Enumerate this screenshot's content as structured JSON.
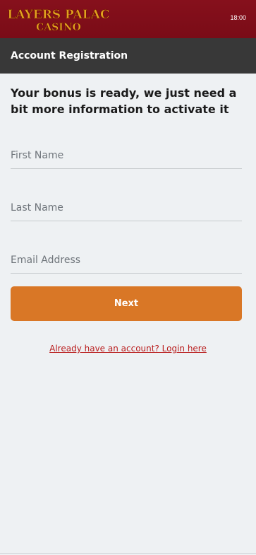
{
  "status_bar": {
    "time": "18:00"
  },
  "brand": {
    "line1": "PLAYERS PALACE",
    "line2": "CASINO",
    "logo_color": "#e0a21f",
    "topbar_color": "#7f0e19"
  },
  "header": {
    "title": "Account Registration"
  },
  "intro": {
    "text": "Your bonus is ready, we just need a bit more information to activate it"
  },
  "form": {
    "first_name": {
      "placeholder": "First Name",
      "value": ""
    },
    "last_name": {
      "placeholder": "Last Name",
      "value": ""
    },
    "email": {
      "placeholder": "Email Address",
      "value": ""
    },
    "next_label": "Next",
    "next_color": "#d97726"
  },
  "footer": {
    "login_link": "Already have an account? Login here"
  }
}
